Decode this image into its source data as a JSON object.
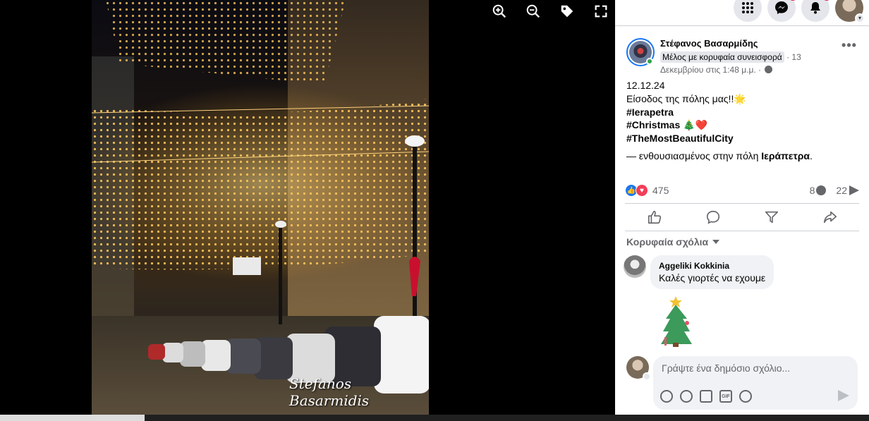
{
  "viewer": {
    "watermark": "Stefanos Basarmidis",
    "tools": [
      {
        "icon": "zoom-in-icon"
      },
      {
        "icon": "zoom-out-icon"
      },
      {
        "icon": "tag-icon"
      },
      {
        "icon": "fullscreen-icon"
      }
    ]
  },
  "topbar": {
    "icons": [
      "apps-grid-icon",
      "messenger-icon",
      "notifications-icon"
    ]
  },
  "post": {
    "author": "Στέφανος Βασαρμίδης",
    "badge": "Μέλος με κορυφαία συνεισφορά",
    "date_part1": " · 13",
    "date_part2": "Δεκεμβρίου στις 1:48 μ.μ. · ",
    "line1": "12.12.24",
    "line2": "Είσοδος της πόλης μας!!🌟",
    "tag1": "#Ierapetra",
    "tag2": "#Christmas",
    "tag2_emoji": " 🎄❤️",
    "tag3": "#TheMostBeautifulCity",
    "feeling_prefix": "— ενθουσιασμένος στην πόλη ",
    "feeling_place": "Ιεράπετρα",
    "feeling_suffix": "."
  },
  "stats": {
    "reactions": "475",
    "comments": "8",
    "shares": "22"
  },
  "comments_section": {
    "sort_label": "Κορυφαία σχόλια",
    "comment": {
      "name": "Aggeliki Kokkinia",
      "text": "Καλές γιορτές να εχουμε"
    }
  },
  "composer": {
    "placeholder": "Γράψτε ένα δημόσιο σχόλιο...",
    "gif_label": "GIF"
  },
  "colors": {
    "accent": "#1877f2",
    "love": "#f33e58",
    "online": "#31a24c"
  }
}
